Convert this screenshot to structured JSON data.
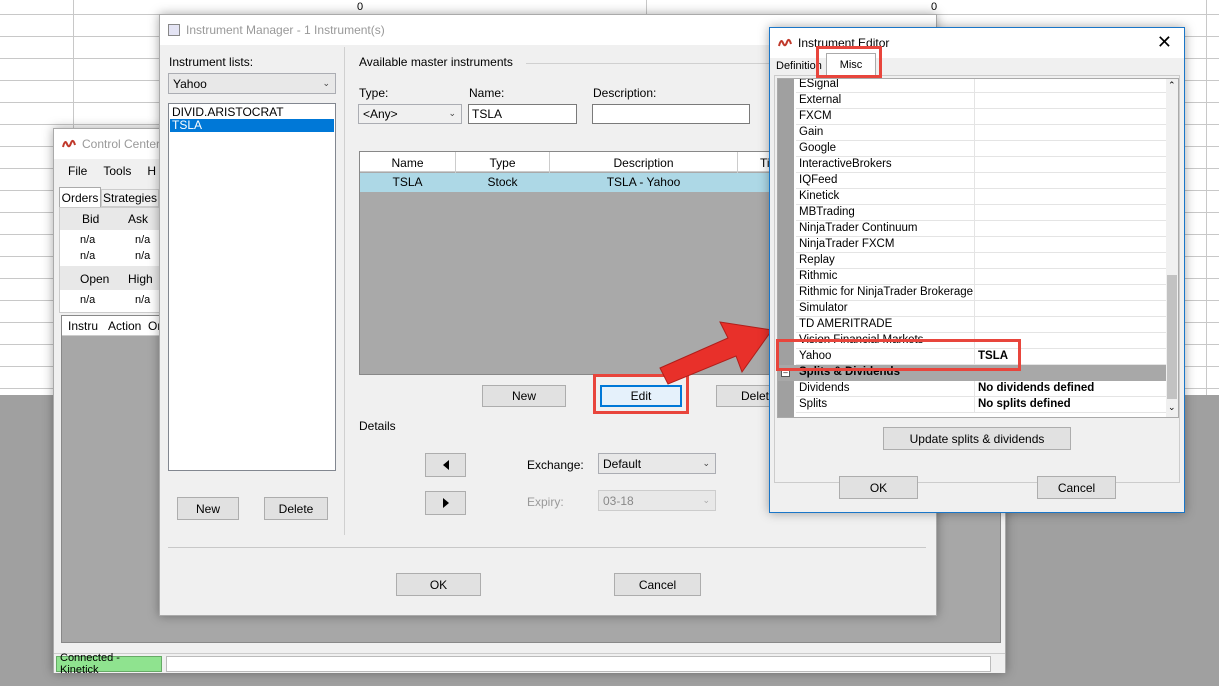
{
  "background_grid": {
    "col_value_1": "0",
    "col_value_2": "0"
  },
  "control_center": {
    "title": "Control Center",
    "menu": [
      "File",
      "Tools",
      "H"
    ],
    "tabs": [
      "Orders",
      "Strategies"
    ],
    "quote_headers_1": [
      "Bid",
      "Ask"
    ],
    "quote_rows_1": [
      [
        "n/a",
        "n/a"
      ],
      [
        "n/a",
        "n/a"
      ]
    ],
    "quote_headers_2": [
      "Open",
      "High"
    ],
    "quote_rows_2": [
      [
        "n/a",
        "n/a"
      ]
    ],
    "orders_headers": [
      "Instru",
      "Action",
      "Or"
    ],
    "status_connected": "Connected - Kinetick"
  },
  "instrument_manager": {
    "title": "Instrument Manager - 1 Instrument(s)",
    "lists_label": "Instrument lists:",
    "lists_selected": "Yahoo",
    "list_items": [
      "DIVID.ARISTOCRAT",
      "TSLA"
    ],
    "left_new": "New",
    "left_delete": "Delete",
    "available_label": "Available master instruments",
    "type_label": "Type:",
    "type_value": "<Any>",
    "name_label": "Name:",
    "name_value": "TSLA",
    "description_label": "Description:",
    "description_value": "",
    "table_headers": [
      "Name",
      "Type",
      "Description",
      "Ti"
    ],
    "table_rows": [
      [
        "TSLA",
        "Stock",
        "TSLA - Yahoo",
        ""
      ]
    ],
    "new_button": "New",
    "edit_button": "Edit",
    "delete_button": "Delete",
    "details_label": "Details",
    "exchange_label": "Exchange:",
    "exchange_value": "Default",
    "expiry_label": "Expiry:",
    "expiry_value": "03-18",
    "ok_button": "OK",
    "cancel_button": "Cancel"
  },
  "instrument_editor": {
    "title": "Instrument Editor",
    "tabs": [
      "Definition",
      "Misc"
    ],
    "properties": [
      {
        "name": "ESignal",
        "value": ""
      },
      {
        "name": "External",
        "value": ""
      },
      {
        "name": "FXCM",
        "value": ""
      },
      {
        "name": "Gain",
        "value": ""
      },
      {
        "name": "Google",
        "value": ""
      },
      {
        "name": "InteractiveBrokers",
        "value": ""
      },
      {
        "name": "IQFeed",
        "value": ""
      },
      {
        "name": "Kinetick",
        "value": ""
      },
      {
        "name": "MBTrading",
        "value": ""
      },
      {
        "name": "NinjaTrader Continuum",
        "value": ""
      },
      {
        "name": "NinjaTrader FXCM",
        "value": ""
      },
      {
        "name": "Replay",
        "value": ""
      },
      {
        "name": "Rithmic",
        "value": ""
      },
      {
        "name": "Rithmic for NinjaTrader Brokerage",
        "value": ""
      },
      {
        "name": "Simulator",
        "value": ""
      },
      {
        "name": "TD AMERITRADE",
        "value": ""
      },
      {
        "name": "Vision Financial Markets",
        "value": ""
      }
    ],
    "yahoo_row": {
      "name": "Yahoo",
      "value": "TSLA"
    },
    "category": "Splits & Dividends",
    "split_rows": [
      {
        "name": "Dividends",
        "value": "No dividends defined"
      },
      {
        "name": "Splits",
        "value": "No splits defined"
      }
    ],
    "update_button": "Update splits & dividends",
    "ok_button": "OK",
    "cancel_button": "Cancel"
  },
  "colors": {
    "highlight_red": "#e8453c",
    "selection_blue": "#0078d7",
    "row_blue": "#add8e6",
    "status_green": "#8fe38f"
  }
}
